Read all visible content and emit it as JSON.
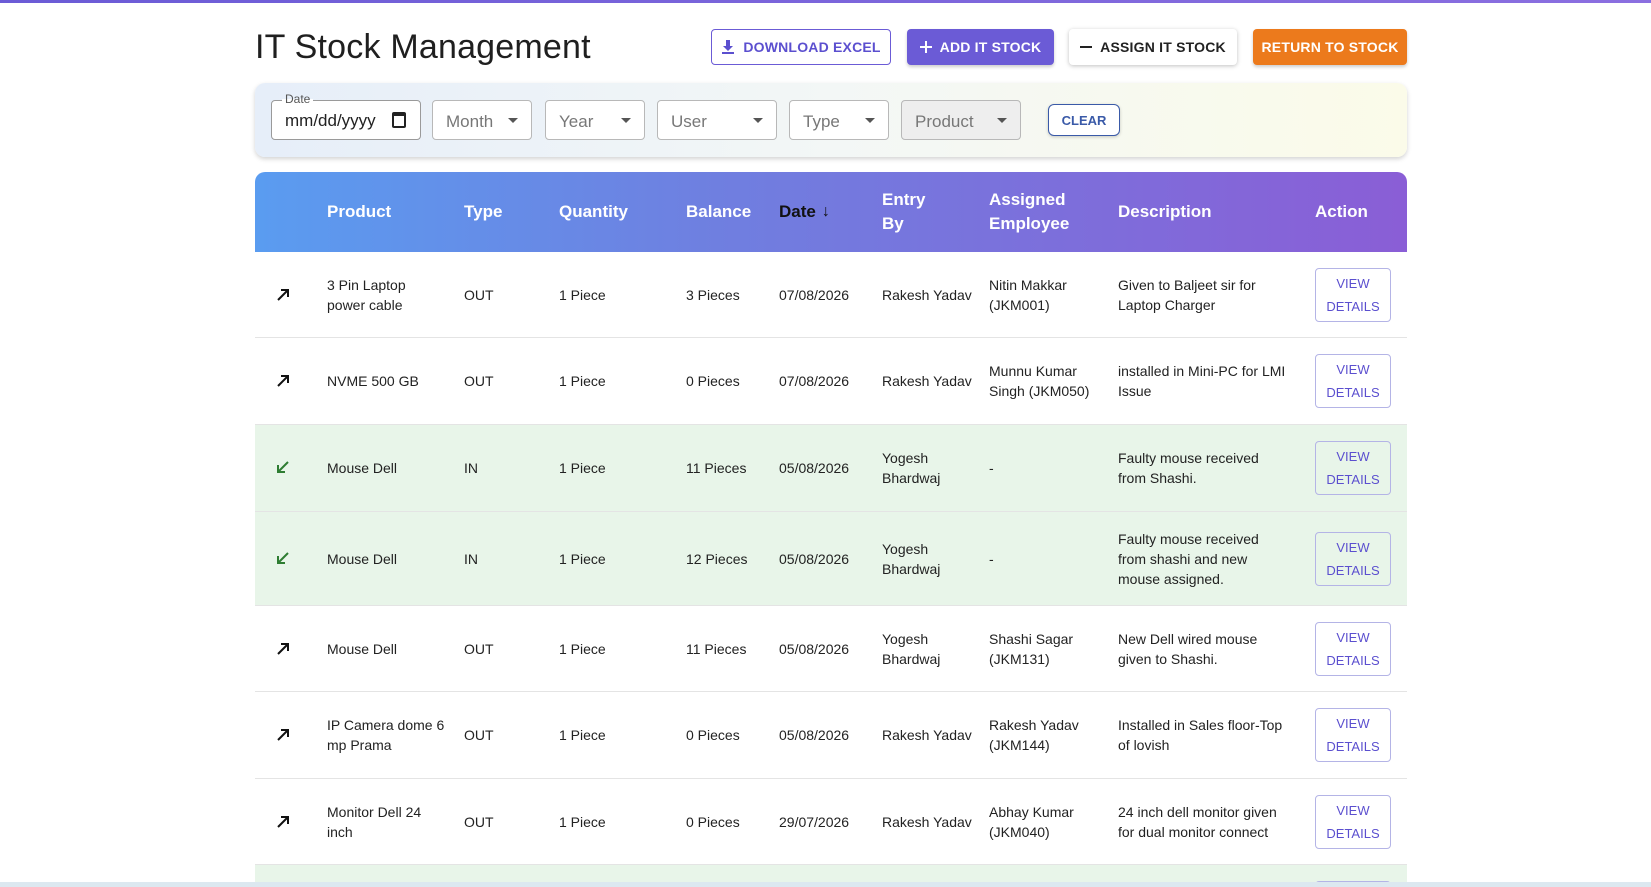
{
  "page": {
    "title": "IT Stock Management"
  },
  "toolbar": {
    "download_label": "Download Excel",
    "add_label": "Add IT Stock",
    "assign_label": "Assign IT Stock",
    "return_label": "Return to Stock"
  },
  "filters": {
    "date_label": "Date",
    "date_value": "mm/dd/yyyy",
    "month": "Month",
    "year": "Year",
    "user": "User",
    "type": "Type",
    "product": "Product",
    "clear_label": "Clear"
  },
  "table": {
    "columns": {
      "product": "Product",
      "type": "Type",
      "quantity": "Quantity",
      "balance": "Balance",
      "date": "Date",
      "entry_by": "Entry By",
      "assigned_employee": "Assigned Employee",
      "description": "Description",
      "action": "Action"
    },
    "sort_indicator": "↓",
    "view_label_1": "View",
    "view_label_2": "Details",
    "rows": [
      {
        "direction": "out",
        "product": "3 Pin Laptop power cable",
        "type": "OUT",
        "quantity": "1 Piece",
        "balance": "3 Pieces",
        "date": "07/08/2026",
        "entry_by": "Rakesh Yadav",
        "assigned": "Nitin Makkar (JKM001)",
        "description": "Given to Baljeet sir for Laptop Charger"
      },
      {
        "direction": "out",
        "product": "NVME 500 GB",
        "type": "OUT",
        "quantity": "1 Piece",
        "balance": "0 Pieces",
        "date": "07/08/2026",
        "entry_by": "Rakesh Yadav",
        "assigned": "Munnu Kumar Singh (JKM050)",
        "description": "installed in Mini-PC for LMI Issue"
      },
      {
        "direction": "in",
        "product": "Mouse Dell",
        "type": "IN",
        "quantity": "1 Piece",
        "balance": "11 Pieces",
        "date": "05/08/2026",
        "entry_by": "Yogesh Bhardwaj",
        "assigned": "-",
        "description": "Faulty mouse received from Shashi."
      },
      {
        "direction": "in",
        "product": "Mouse Dell",
        "type": "IN",
        "quantity": "1 Piece",
        "balance": "12 Pieces",
        "date": "05/08/2026",
        "entry_by": "Yogesh Bhardwaj",
        "assigned": "-",
        "description": "Faulty mouse received from shashi and new mouse assigned."
      },
      {
        "direction": "out",
        "product": "Mouse Dell",
        "type": "OUT",
        "quantity": "1 Piece",
        "balance": "11 Pieces",
        "date": "05/08/2026",
        "entry_by": "Yogesh Bhardwaj",
        "assigned": "Shashi Sagar (JKM131)",
        "description": "New Dell wired mouse given to Shashi."
      },
      {
        "direction": "out",
        "product": "IP Camera dome 6 mp Prama",
        "type": "OUT",
        "quantity": "1 Piece",
        "balance": "0 Pieces",
        "date": "05/08/2026",
        "entry_by": "Rakesh Yadav",
        "assigned": "Rakesh Yadav (JKM144)",
        "description": "Installed in Sales floor-Top of lovish"
      },
      {
        "direction": "out",
        "product": "Monitor Dell 24 inch",
        "type": "OUT",
        "quantity": "1 Piece",
        "balance": "0 Pieces",
        "date": "29/07/2026",
        "entry_by": "Rakesh Yadav",
        "assigned": "Abhay Kumar (JKM040)",
        "description": "24 inch dell monitor given for dual monitor connect"
      }
    ]
  },
  "icons": {
    "out": "arrow-up-right-icon",
    "in": "arrow-down-left-icon"
  },
  "colors": {
    "primary": "#6b5bd6",
    "return": "#ec7a1c",
    "in_row": "#e8f5e9",
    "in_arrow": "#2e7d32"
  }
}
